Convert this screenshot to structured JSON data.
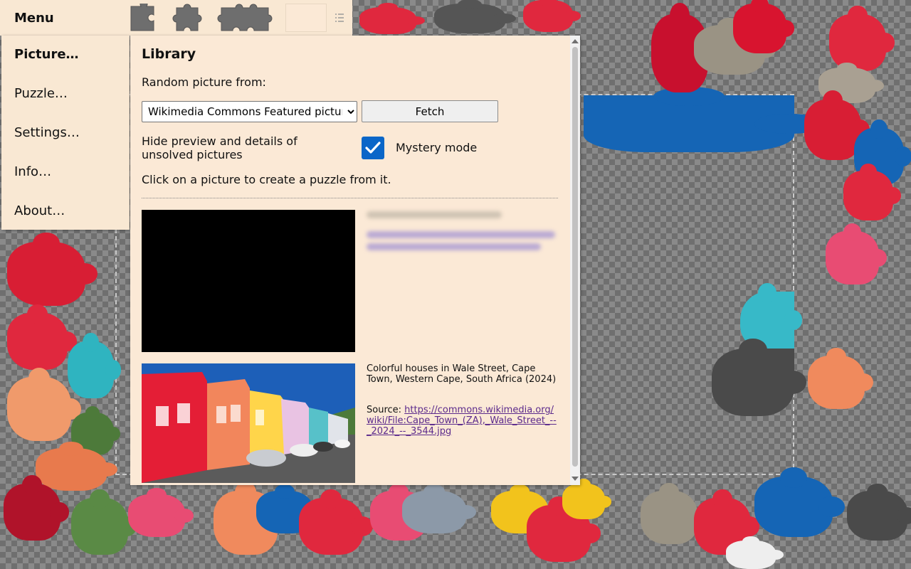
{
  "topbar": {
    "menu_label": "Menu"
  },
  "menu": {
    "items": [
      {
        "label": "Picture…",
        "active": true
      },
      {
        "label": "Puzzle…",
        "active": false
      },
      {
        "label": "Settings…",
        "active": false
      },
      {
        "label": "Info…",
        "active": false
      },
      {
        "label": "About…",
        "active": false
      }
    ]
  },
  "library": {
    "title": "Library",
    "random_label": "Random picture from:",
    "source_selected": "Wikimedia Commons Featured picture",
    "fetch_label": "Fetch",
    "hide_label": "Hide preview and details of unsolved pictures",
    "mystery_label": "Mystery mode",
    "mystery_checked": true,
    "hint": "Click on a picture to create a puzzle from it.",
    "pictures": [
      {
        "caption": "Colorful houses in Wale Street, Cape Town, Western Cape, South Africa (2024)",
        "source_prefix": "Source: ",
        "source_url": "https://commons.wikimedia.org/wiki/File:Cape_Town_(ZA),_Wale_Street_--_2024_--_3544.jpg"
      }
    ]
  },
  "colors": {
    "panel_bg": "#fbe9d6",
    "accent_check": "#0a66c8",
    "link": "#5b2a8c"
  }
}
